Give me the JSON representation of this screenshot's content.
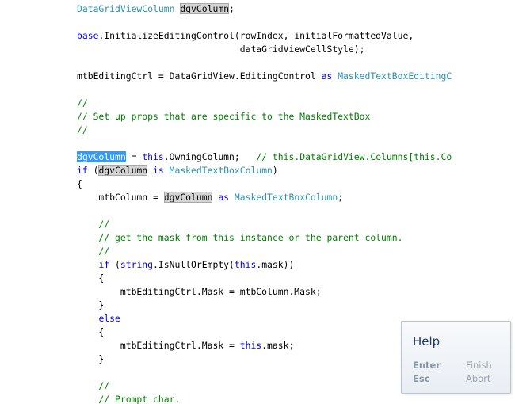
{
  "code": {
    "lines": [
      [
        {
          "t": "DataGridViewColumn",
          "c": "ty"
        },
        {
          "t": " ",
          "c": "pl"
        },
        {
          "t": "dgvColumn",
          "c": "hl"
        },
        {
          "t": ";",
          "c": "pl"
        }
      ],
      [],
      [
        {
          "t": "base",
          "c": "kw"
        },
        {
          "t": ".InitializeEditingControl(rowIndex, initialFormattedValue,",
          "c": "pl"
        }
      ],
      [
        {
          "t": "                              dataGridViewCellStyle);",
          "c": "pl"
        }
      ],
      [],
      [
        {
          "t": "mtbEditingCtrl = DataGridView.EditingControl ",
          "c": "pl"
        },
        {
          "t": "as",
          "c": "kw"
        },
        {
          "t": " ",
          "c": "pl"
        },
        {
          "t": "MaskedTextBoxEditingC",
          "c": "ty"
        }
      ],
      [],
      [
        {
          "t": "//",
          "c": "cm"
        }
      ],
      [
        {
          "t": "// Set up props that are specific to the MaskedTextBox",
          "c": "cm"
        }
      ],
      [
        {
          "t": "//",
          "c": "cm"
        }
      ],
      [],
      [
        {
          "t": "dgvColumn",
          "c": "sel"
        },
        {
          "t": " = ",
          "c": "pl"
        },
        {
          "t": "this",
          "c": "kw"
        },
        {
          "t": ".OwningColumn;   ",
          "c": "pl"
        },
        {
          "t": "// this.DataGridView.Columns[this.Co",
          "c": "cm"
        }
      ],
      [
        {
          "t": "if",
          "c": "kw"
        },
        {
          "t": " (",
          "c": "pl"
        },
        {
          "t": "dgvColumn",
          "c": "hl"
        },
        {
          "t": " ",
          "c": "pl"
        },
        {
          "t": "is",
          "c": "kw"
        },
        {
          "t": " ",
          "c": "pl"
        },
        {
          "t": "MaskedTextBoxColumn",
          "c": "ty"
        },
        {
          "t": ")",
          "c": "pl"
        }
      ],
      [
        {
          "t": "{",
          "c": "pl"
        }
      ],
      [
        {
          "t": "    mtbColumn = ",
          "c": "pl"
        },
        {
          "t": "dgvColumn",
          "c": "hl"
        },
        {
          "t": " ",
          "c": "pl"
        },
        {
          "t": "as",
          "c": "kw"
        },
        {
          "t": " ",
          "c": "pl"
        },
        {
          "t": "MaskedTextBoxColumn",
          "c": "ty"
        },
        {
          "t": ";",
          "c": "pl"
        }
      ],
      [],
      [
        {
          "t": "    //",
          "c": "cm"
        }
      ],
      [
        {
          "t": "    // get the mask from this instance or the parent column.",
          "c": "cm"
        }
      ],
      [
        {
          "t": "    //",
          "c": "cm"
        }
      ],
      [
        {
          "t": "    ",
          "c": "pl"
        },
        {
          "t": "if",
          "c": "kw"
        },
        {
          "t": " (",
          "c": "pl"
        },
        {
          "t": "string",
          "c": "kw"
        },
        {
          "t": ".IsNullOrEmpty(",
          "c": "pl"
        },
        {
          "t": "this",
          "c": "kw"
        },
        {
          "t": ".mask))",
          "c": "pl"
        }
      ],
      [
        {
          "t": "    {",
          "c": "pl"
        }
      ],
      [
        {
          "t": "        mtbEditingCtrl.Mask = mtbColumn.Mask;",
          "c": "pl"
        }
      ],
      [
        {
          "t": "    }",
          "c": "pl"
        }
      ],
      [
        {
          "t": "    ",
          "c": "pl"
        },
        {
          "t": "else",
          "c": "kw"
        }
      ],
      [
        {
          "t": "    {",
          "c": "pl"
        }
      ],
      [
        {
          "t": "        mtbEditingCtrl.Mask = ",
          "c": "pl"
        },
        {
          "t": "this",
          "c": "kw"
        },
        {
          "t": ".mask;",
          "c": "pl"
        }
      ],
      [
        {
          "t": "    }",
          "c": "pl"
        }
      ],
      [],
      [
        {
          "t": "    //",
          "c": "cm"
        }
      ],
      [
        {
          "t": "    // Prompt char.",
          "c": "cm"
        }
      ]
    ]
  },
  "help_popup": {
    "title": "Help",
    "enter_key": "Enter",
    "finish_label": "Finish",
    "esc_key": "Esc",
    "abort_label": "Abort"
  },
  "colors": {
    "keyword": "#0000ff",
    "type": "#2b91af",
    "comment": "#008000",
    "selection": "#3399ff",
    "highlight": "#d4d4d4"
  }
}
